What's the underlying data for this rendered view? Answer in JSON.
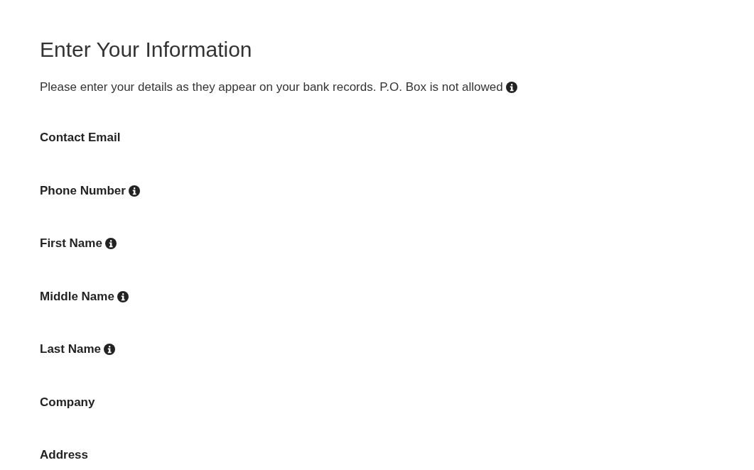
{
  "heading": "Enter Your Information",
  "intro": {
    "text": "Please enter your details as they appear on your bank records. P.O. Box is not allowed",
    "info": true
  },
  "fields": [
    {
      "label": "Contact Email",
      "info": false
    },
    {
      "label": "Phone Number",
      "info": true
    },
    {
      "label": "First Name",
      "info": true
    },
    {
      "label": "Middle Name",
      "info": true
    },
    {
      "label": "Last Name",
      "info": true
    },
    {
      "label": "Company",
      "info": false
    },
    {
      "label": "Address",
      "info": false
    }
  ]
}
